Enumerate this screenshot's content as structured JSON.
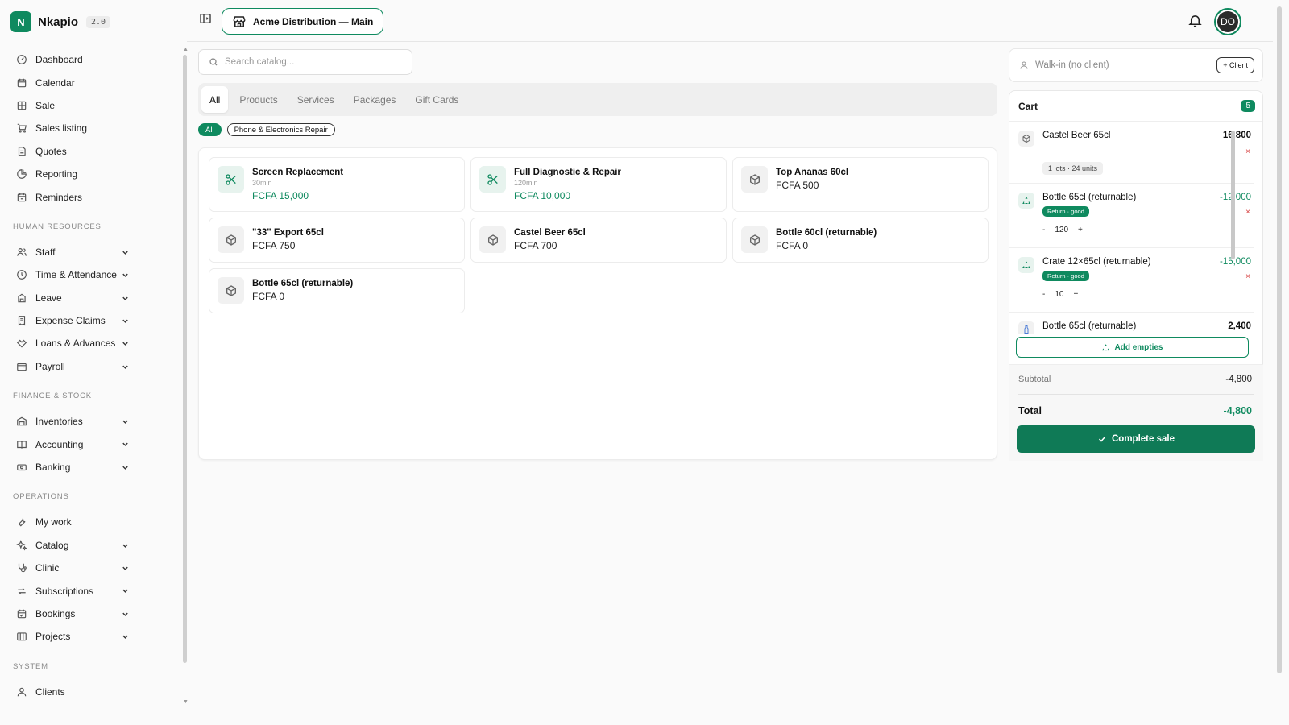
{
  "brand": {
    "name": "Nkapio",
    "version": "2.0",
    "logo_letter": "N"
  },
  "colors": {
    "accent": "#0f8a5f",
    "danger": "#d63b3b"
  },
  "nav": {
    "main": [
      {
        "label": "Dashboard",
        "icon": "dashboard-icon"
      },
      {
        "label": "Calendar",
        "icon": "calendar-icon"
      },
      {
        "label": "Sale",
        "icon": "pos-icon"
      },
      {
        "label": "Sales listing",
        "icon": "cart-icon"
      },
      {
        "label": "Quotes",
        "icon": "document-icon"
      },
      {
        "label": "Reporting",
        "icon": "pie-chart-icon"
      },
      {
        "label": "Reminders",
        "icon": "calendar-bell-icon"
      }
    ],
    "hr_title": "HUMAN RESOURCES",
    "hr": [
      {
        "label": "Staff",
        "icon": "users-icon"
      },
      {
        "label": "Time & Attendance",
        "icon": "clock-icon"
      },
      {
        "label": "Leave",
        "icon": "leave-icon"
      },
      {
        "label": "Expense Claims",
        "icon": "receipt-icon"
      },
      {
        "label": "Loans & Advances",
        "icon": "handshake-icon"
      },
      {
        "label": "Payroll",
        "icon": "wallet-icon"
      }
    ],
    "finance_title": "FINANCE & STOCK",
    "finance": [
      {
        "label": "Inventories",
        "icon": "warehouse-icon"
      },
      {
        "label": "Accounting",
        "icon": "book-icon"
      },
      {
        "label": "Banking",
        "icon": "banknote-icon"
      }
    ],
    "ops_title": "OPERATIONS",
    "ops": [
      {
        "label": "My work",
        "icon": "wrench-icon"
      },
      {
        "label": "Catalog",
        "icon": "sparkles-icon"
      },
      {
        "label": "Clinic",
        "icon": "stethoscope-icon"
      },
      {
        "label": "Subscriptions",
        "icon": "repeat-icon"
      },
      {
        "label": "Bookings",
        "icon": "calendar-check-icon"
      },
      {
        "label": "Projects",
        "icon": "projects-icon"
      }
    ],
    "system_title": "SYSTEM",
    "system": [
      {
        "label": "Clients",
        "icon": "user-icon"
      }
    ]
  },
  "topbar": {
    "branch": "Acme Distribution — Main",
    "avatar_initials": "DO"
  },
  "catalog": {
    "search_placeholder": "Search catalog...",
    "tabs": [
      "All",
      "Products",
      "Services",
      "Packages",
      "Gift Cards"
    ],
    "active_tab": "All",
    "chips": [
      "All",
      "Phone & Electronics Repair"
    ],
    "items": [
      {
        "name": "Screen Replacement",
        "duration": "30min",
        "price": "FCFA 15,000",
        "kind": "service"
      },
      {
        "name": "Full Diagnostic & Repair",
        "duration": "120min",
        "price": "FCFA 10,000",
        "kind": "service"
      },
      {
        "name": "Top Ananas 60cl",
        "duration": "",
        "price": "FCFA 500",
        "kind": "product"
      },
      {
        "name": "\"33\" Export 65cl",
        "duration": "",
        "price": "FCFA 750",
        "kind": "product"
      },
      {
        "name": "Castel Beer 65cl",
        "duration": "",
        "price": "FCFA 700",
        "kind": "product"
      },
      {
        "name": "Bottle 60cl (returnable)",
        "duration": "",
        "price": "FCFA 0",
        "kind": "product"
      },
      {
        "name": "Bottle 65cl (returnable)",
        "duration": "",
        "price": "FCFA 0",
        "kind": "product"
      }
    ]
  },
  "client": {
    "placeholder": "Walk-in (no client)",
    "add_label": "+ Client"
  },
  "cart": {
    "title": "Cart",
    "count": "5",
    "items": [
      {
        "name": "Castel Beer 65cl",
        "amount": "16,800",
        "lots": "1 lots · 24 units"
      },
      {
        "name": "Bottle 65cl (returnable)",
        "amount": "-12,000",
        "badge": "Return · good",
        "qty": "120"
      },
      {
        "name": "Crate 12×65cl (returnable)",
        "amount": "-15,000",
        "badge": "Return · good",
        "qty": "10"
      },
      {
        "name": "Bottle 65cl (returnable)",
        "amount": "2,400"
      }
    ],
    "remove_glyph": "×",
    "minus_glyph": "-",
    "plus_glyph": "+",
    "add_empties": "Add empties",
    "subtotal_label": "Subtotal",
    "subtotal": "-4,800",
    "total_label": "Total",
    "total": "-4,800",
    "complete_label": "Complete sale"
  }
}
